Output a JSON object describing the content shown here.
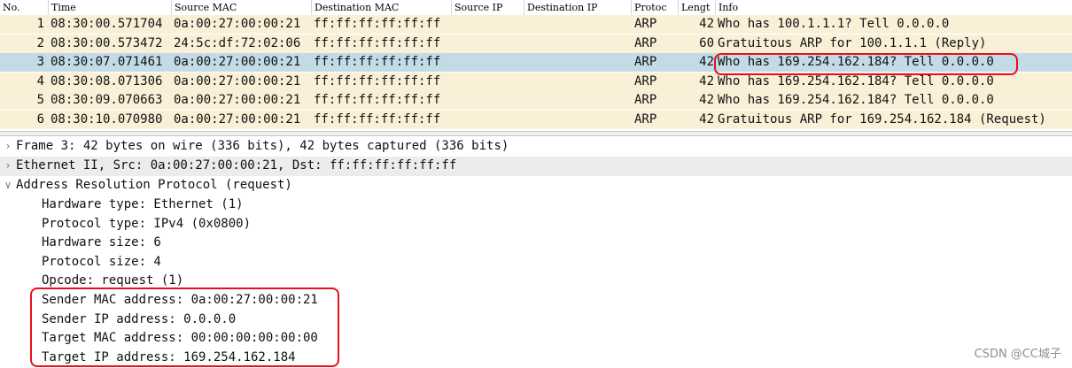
{
  "columns": [
    "No.",
    "Time",
    "Source MAC",
    "Destination MAC",
    "Source IP",
    "Destination IP",
    "Protoc",
    "Lengt",
    "Info"
  ],
  "packets": [
    {
      "no": "1",
      "time": "08:30:00.571704",
      "src_mac": "0a:00:27:00:00:21",
      "dst_mac": "ff:ff:ff:ff:ff:ff",
      "src_ip": "",
      "dst_ip": "",
      "proto": "ARP",
      "len": "42",
      "info": "Who has 100.1.1.1? Tell 0.0.0.0"
    },
    {
      "no": "2",
      "time": "08:30:00.573472",
      "src_mac": "24:5c:df:72:02:06",
      "dst_mac": "ff:ff:ff:ff:ff:ff",
      "src_ip": "",
      "dst_ip": "",
      "proto": "ARP",
      "len": "60",
      "info": "Gratuitous ARP for 100.1.1.1 (Reply)"
    },
    {
      "no": "3",
      "time": "08:30:07.071461",
      "src_mac": "0a:00:27:00:00:21",
      "dst_mac": "ff:ff:ff:ff:ff:ff",
      "src_ip": "",
      "dst_ip": "",
      "proto": "ARP",
      "len": "42",
      "info": "Who has 169.254.162.184? Tell 0.0.0.0"
    },
    {
      "no": "4",
      "time": "08:30:08.071306",
      "src_mac": "0a:00:27:00:00:21",
      "dst_mac": "ff:ff:ff:ff:ff:ff",
      "src_ip": "",
      "dst_ip": "",
      "proto": "ARP",
      "len": "42",
      "info": "Who has 169.254.162.184? Tell 0.0.0.0"
    },
    {
      "no": "5",
      "time": "08:30:09.070663",
      "src_mac": "0a:00:27:00:00:21",
      "dst_mac": "ff:ff:ff:ff:ff:ff",
      "src_ip": "",
      "dst_ip": "",
      "proto": "ARP",
      "len": "42",
      "info": "Who has 169.254.162.184? Tell 0.0.0.0"
    },
    {
      "no": "6",
      "time": "08:30:10.070980",
      "src_mac": "0a:00:27:00:00:21",
      "dst_mac": "ff:ff:ff:ff:ff:ff",
      "src_ip": "",
      "dst_ip": "",
      "proto": "ARP",
      "len": "42",
      "info": "Gratuitous ARP for 169.254.162.184 (Request)"
    }
  ],
  "selected_packet": "3",
  "details": {
    "frame": "Frame 3: 42 bytes on wire (336 bits), 42 bytes captured (336 bits)",
    "ethernet": "Ethernet II, Src: 0a:00:27:00:00:21, Dst: ff:ff:ff:ff:ff:ff",
    "arp": "Address Resolution Protocol (request)",
    "arp_fields": [
      "Hardware type: Ethernet (1)",
      "Protocol type: IPv4 (0x0800)",
      "Hardware size: 6",
      "Protocol size: 4",
      "Opcode: request (1)",
      "Sender MAC address: 0a:00:27:00:00:21",
      "Sender IP address: 0.0.0.0",
      "Target MAC address: 00:00:00:00:00:00",
      "Target IP address: 169.254.162.184"
    ]
  },
  "watermark": "CSDN @CC城子",
  "colors": {
    "arp_row": "#faf0d7",
    "selected_row": "#c2dbe6",
    "annotation": "#e8101c"
  }
}
